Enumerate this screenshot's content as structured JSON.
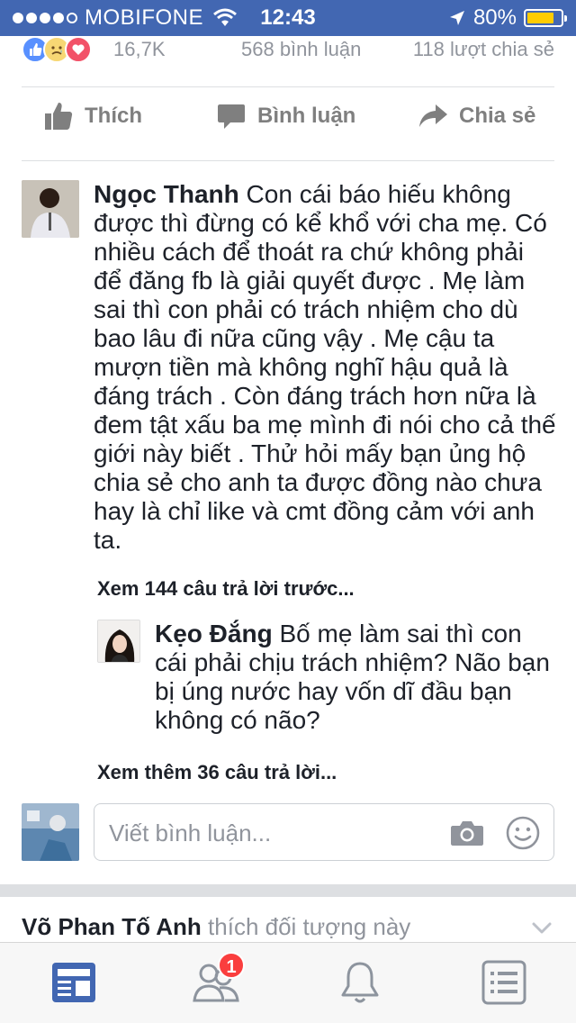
{
  "status_bar": {
    "carrier": "MOBIFONE",
    "time": "12:43",
    "battery_percent": "80%",
    "battery_level": 0.8
  },
  "reactions": {
    "count": "16,7K",
    "comments": "568 bình luận",
    "shares": "118 lượt chia sẻ"
  },
  "actions": {
    "like": "Thích",
    "comment": "Bình luận",
    "share": "Chia sẻ"
  },
  "comments": [
    {
      "author": "Ngọc Thanh",
      "text": "Con cái báo hiếu không được thì đừng có kể khổ với cha mẹ. Có nhiều cách để thoát ra chứ không phải để đăng fb là giải quyết được . Mẹ làm sai thì con phải có trách nhiệm cho dù bao lâu đi nữa cũng vậy . Mẹ cậu ta mượn tiền mà không nghĩ hậu quả là đáng trách . Còn đáng trách hơn nữa là đem tật xấu ba mẹ mình đi nói cho cả thế giới này biết . Thử hỏi mấy bạn ủng hộ chia sẻ cho anh ta được đồng nào chưa hay là chỉ like và cmt đồng cảm với anh ta."
    }
  ],
  "previous_replies": "Xem 144 câu trả lời trước...",
  "reply": {
    "author": "Kẹo Đắng",
    "text": "Bố mẹ làm sai thì con cái phải chịu trách nhiệm? Não bạn bị úng nước hay vốn dĩ đầu bạn không có não?"
  },
  "more_replies": "Xem thêm 36 câu trả lời...",
  "write_comment": {
    "placeholder": "Viết bình luận..."
  },
  "next_story": {
    "name": "Võ Phan Tố Anh",
    "text": "thích đối tượng này"
  },
  "tabbar": {
    "friend_requests_badge": "1"
  },
  "colors": {
    "brand": "#4267b2",
    "link": "#365899",
    "badge": "#fa3e3e",
    "active_tab": "#4267b2"
  }
}
